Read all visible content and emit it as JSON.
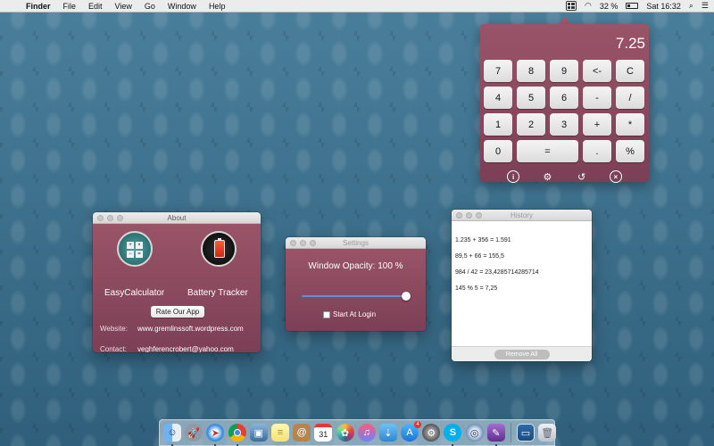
{
  "menubar": {
    "apple_icon": "apple-icon",
    "app_name": "Finder",
    "menus": [
      "File",
      "Edit",
      "View",
      "Go",
      "Window",
      "Help"
    ],
    "battery_percent": "32 %",
    "clock": "Sat 16:32"
  },
  "calculator": {
    "display": "7.25",
    "keys": [
      "7",
      "8",
      "9",
      "<-",
      "C",
      "4",
      "5",
      "6",
      "-",
      "/",
      "1",
      "2",
      "3",
      "+",
      "*",
      "0",
      "=",
      ".",
      "%"
    ],
    "footer_icons": [
      "info-icon",
      "gear-icon",
      "history-icon",
      "close-icon"
    ]
  },
  "about": {
    "title": "About",
    "app1_name": "EasyCalculator",
    "app2_name": "Battery Tracker",
    "rate_button": "Rate Our App",
    "website_label": "Website:",
    "website_value": "www.gremlinssoft.wordpress.com",
    "contact_label": "Contact:",
    "contact_value": "veghferencrobert@yahoo.com"
  },
  "settings": {
    "title": "Settings",
    "opacity_label": "Window Opacity: 100 %",
    "opacity_value": 1.0,
    "start_at_login_label": "Start At Login",
    "start_at_login_checked": false
  },
  "history": {
    "title": "History",
    "entries": [
      "1.235 + 356 = 1.591",
      "89,5 + 66 = 155,5",
      "984 / 42 = 23,4285714285714",
      "145 % 5 = 7,25"
    ],
    "remove_all": "Remove All"
  },
  "dock": {
    "calendar_day": "31",
    "app_store_badge": "4",
    "items": [
      "finder-icon",
      "launchpad-icon",
      "safari-icon",
      "chrome-icon",
      "preview-icon",
      "notes-icon",
      "contacts-icon",
      "calendar-icon",
      "photos-icon",
      "itunes-icon",
      "downloads-icon",
      "app-store-icon",
      "system-preferences-icon",
      "skype-icon",
      "network-icon",
      "screenshot-icon",
      "desktop-folder-icon",
      "trash-icon"
    ]
  }
}
